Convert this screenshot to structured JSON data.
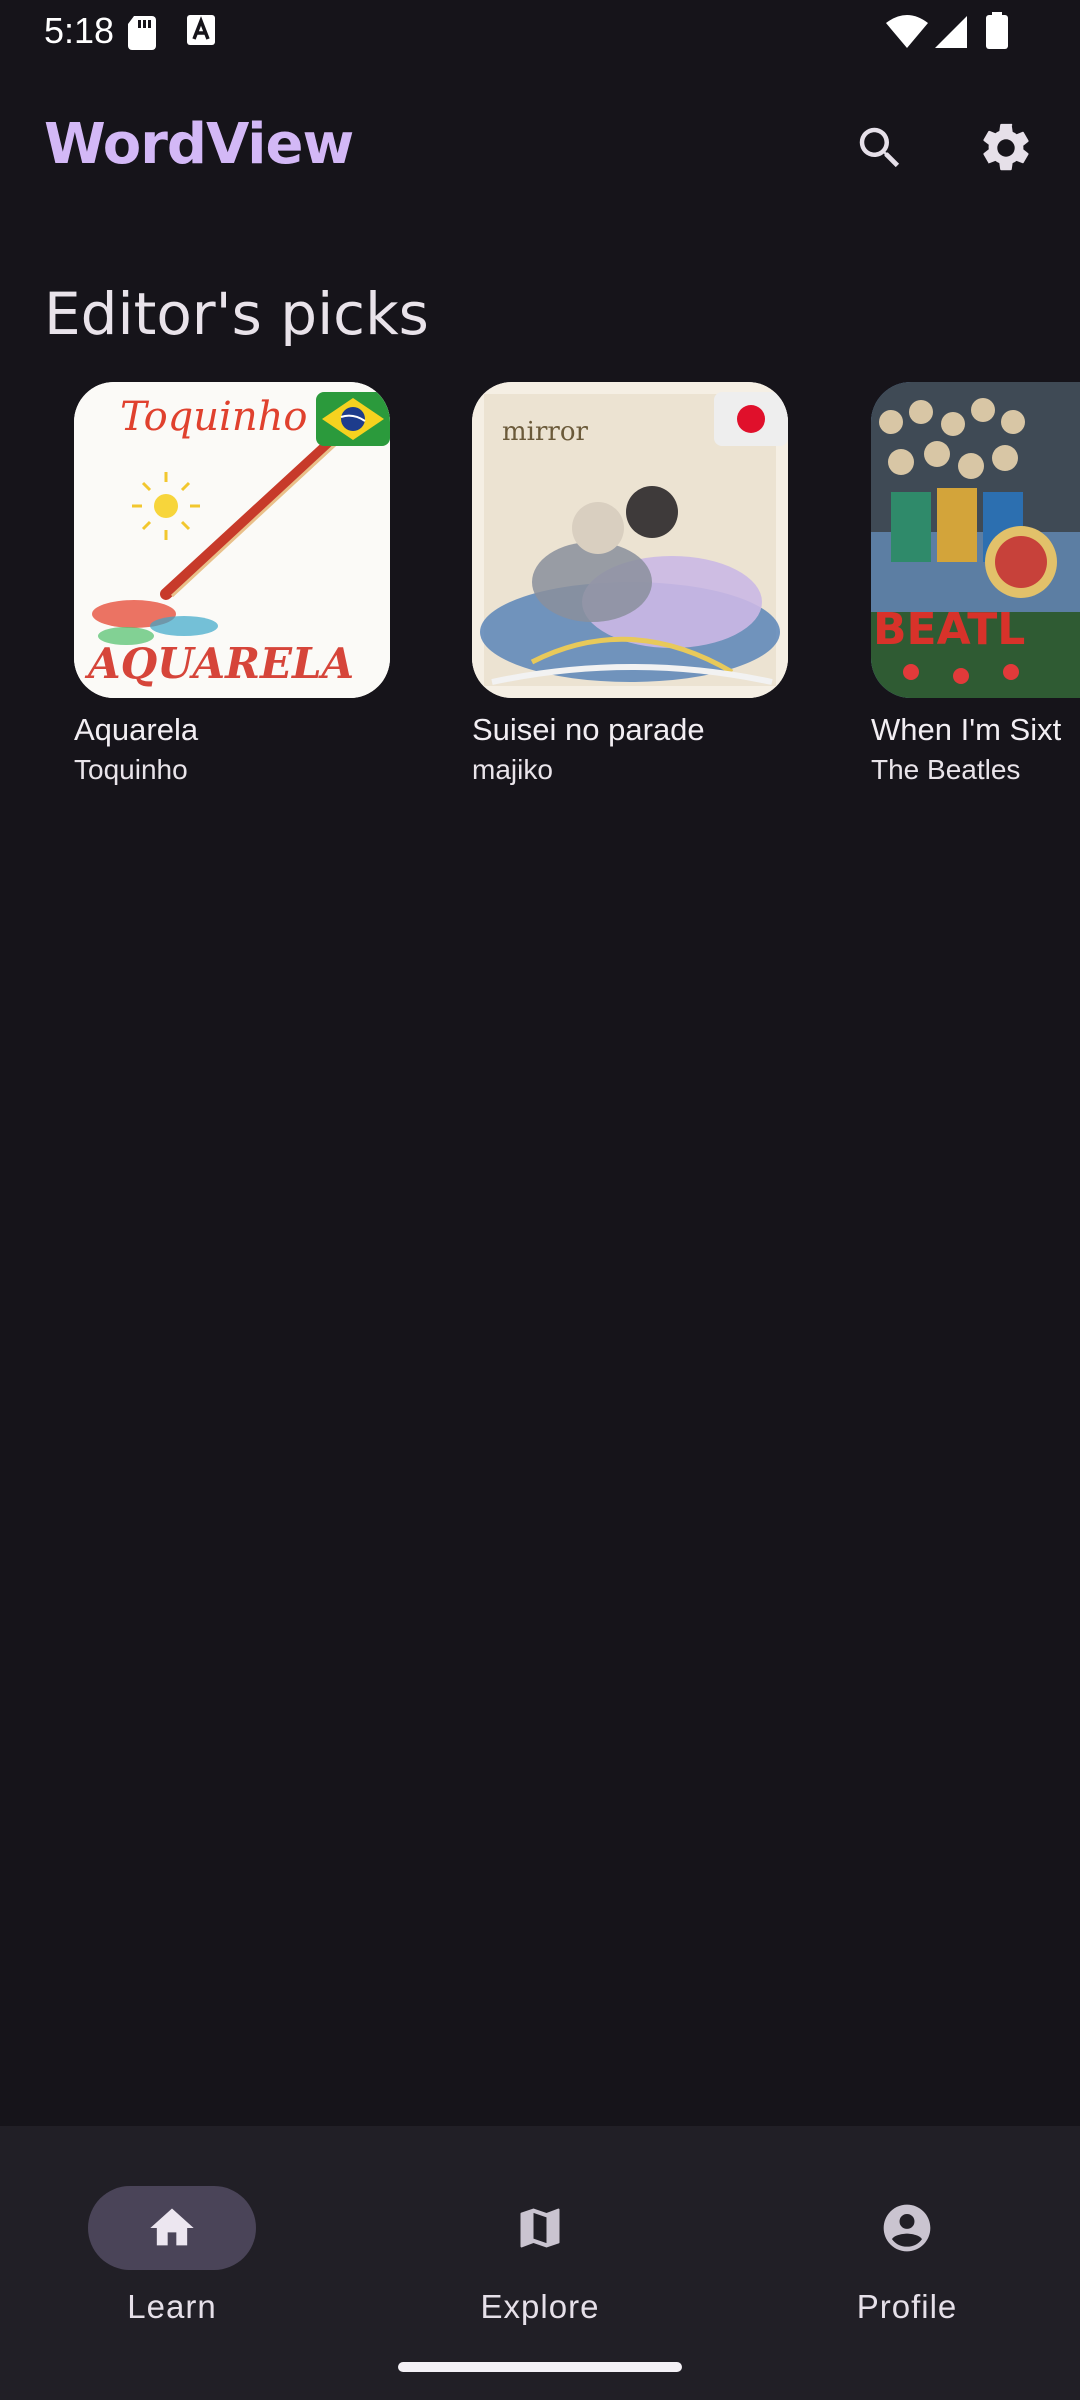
{
  "status_bar": {
    "time": "5:18",
    "icons": [
      "sd-card-icon",
      "a-notification-icon",
      "wifi-icon",
      "signal-icon",
      "battery-icon"
    ]
  },
  "app_bar": {
    "title": "WordView",
    "title_color": "#d3b8f6",
    "actions": [
      "search-icon",
      "settings-icon"
    ]
  },
  "section": {
    "title": "Editor's picks"
  },
  "picks": [
    {
      "title": "Aquarela",
      "artist": "Toquinho",
      "cover_text_top": "Toquinho",
      "cover_text_bottom": "AQUARELA",
      "flag": "brazil-flag-icon"
    },
    {
      "title": "Suisei no parade",
      "artist": "majiko",
      "cover_text_top": "mirror",
      "flag": "japan-flag-icon"
    },
    {
      "title": "When I'm Sixty-Four",
      "title_visible": "When I'm Sixt",
      "artist": "The Beatles",
      "cover_text_bottom": "BEATL"
    }
  ],
  "bottom_nav": {
    "items": [
      {
        "label": "Learn",
        "icon": "home-icon",
        "active": true
      },
      {
        "label": "Explore",
        "icon": "map-icon",
        "active": false
      },
      {
        "label": "Profile",
        "icon": "account-circle-icon",
        "active": false
      }
    ]
  },
  "colors": {
    "background": "#16141a",
    "nav_background": "#211f26",
    "active_pill": "#4a4458"
  }
}
